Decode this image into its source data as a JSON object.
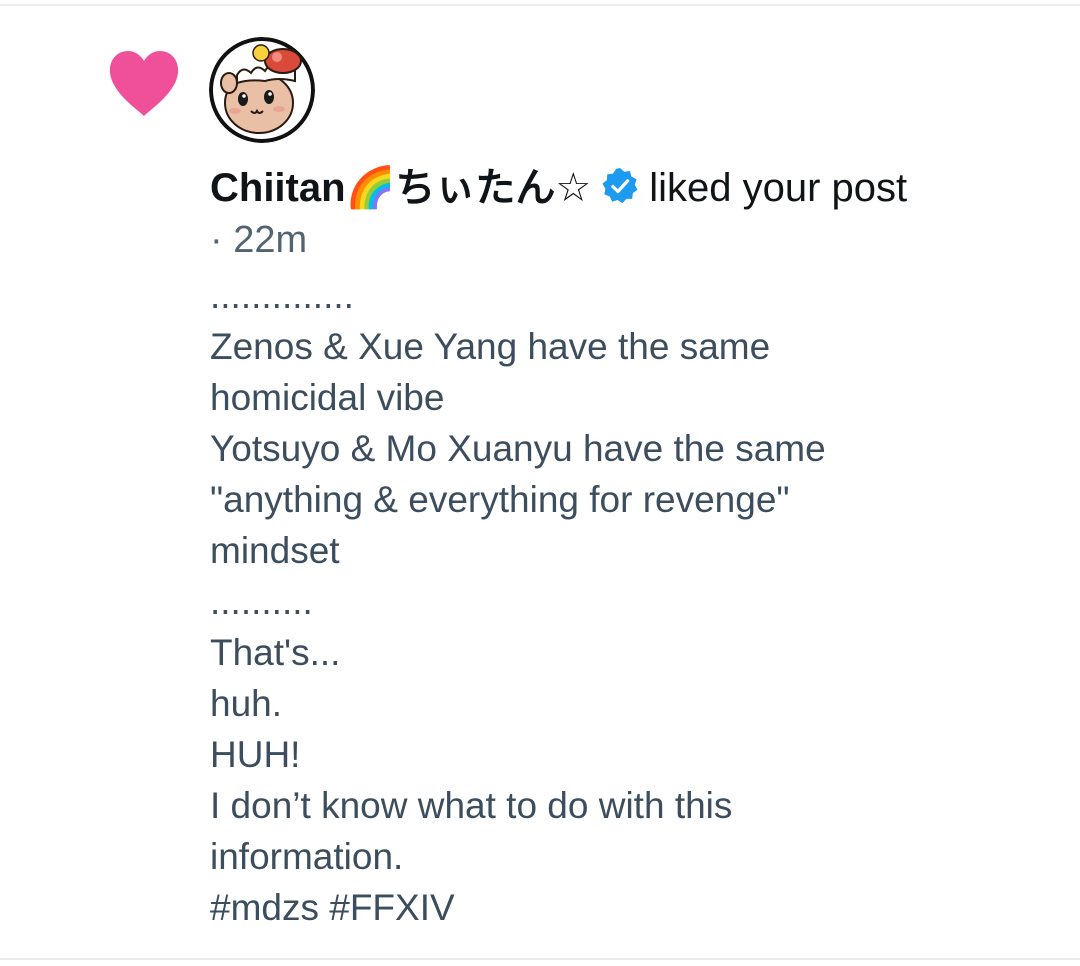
{
  "notification": {
    "username": "Chiitan🌈ちぃたん☆",
    "action_text": "liked your post",
    "timestamp": "· 22m",
    "post_lines": [
      "..............",
      "Zenos & Xue Yang have the same",
      "homicidal vibe",
      "Yotsuyo & Mo Xuanyu have the same",
      "\"anything & everything for revenge\"",
      "mindset",
      "..........",
      "That's...",
      "huh.",
      "HUH!",
      "I don’t know what to do with this",
      "information.",
      "#mdzs #FFXIV"
    ]
  },
  "icons": {
    "like": "heart-icon",
    "avatar": "user-avatar",
    "verified": "verified-badge-icon"
  },
  "colors": {
    "heart": "#f0509a",
    "verified": "#1d9bf0",
    "primary_text": "#0f1419",
    "post_text": "#3c4d5e",
    "muted_text": "#536471"
  }
}
